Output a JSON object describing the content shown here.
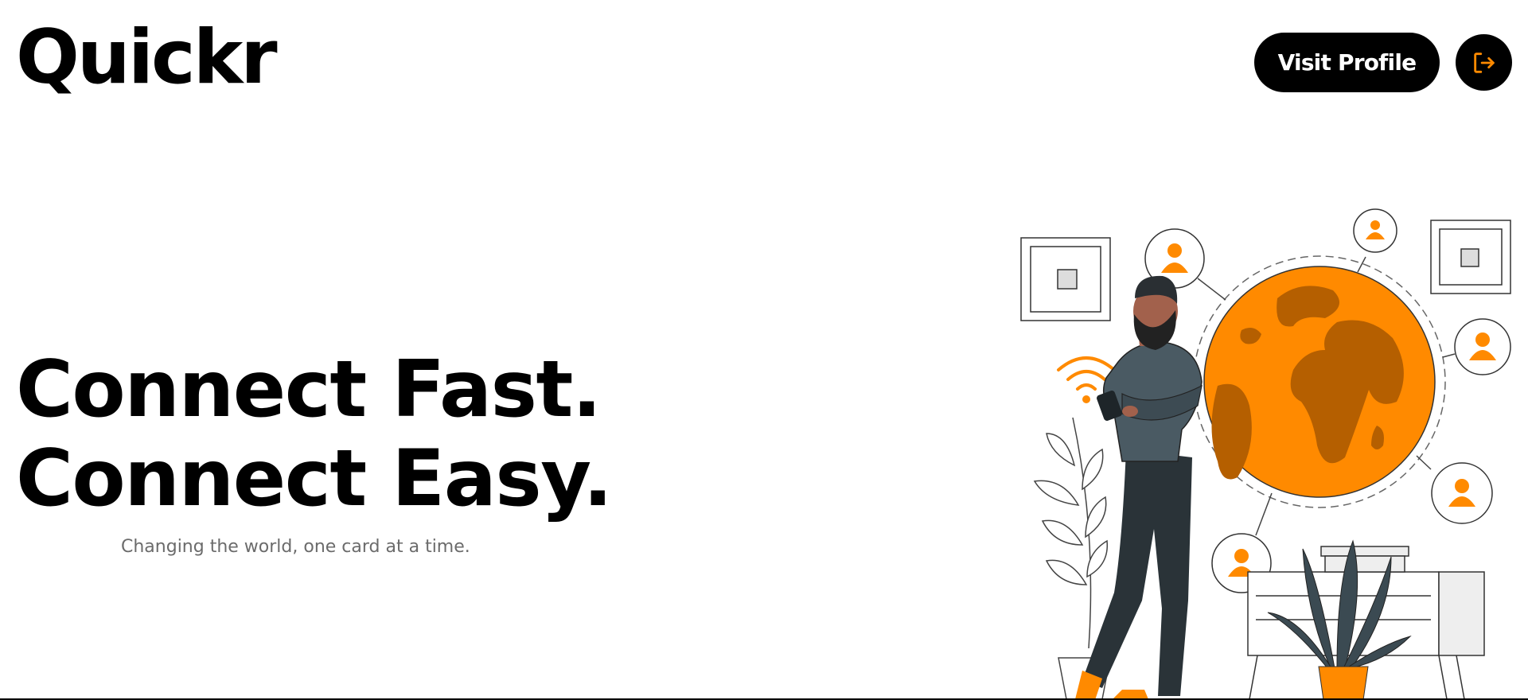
{
  "header": {
    "logo_text": "Quickr",
    "visit_profile_label": "Visit Profile",
    "logout_icon": "logout-icon"
  },
  "hero": {
    "headline_line1": "Connect Fast.",
    "headline_line2": "Connect Easy.",
    "tagline": "Changing the world, one card at a time."
  },
  "colors": {
    "accent": "#ff8a00",
    "accent_dark": "#b55f00",
    "text": "#000000",
    "muted_text": "#6b6b6b",
    "shirt": "#4a5a63"
  },
  "illustration": {
    "subject": "man-with-phone-globe-network-illustration"
  }
}
